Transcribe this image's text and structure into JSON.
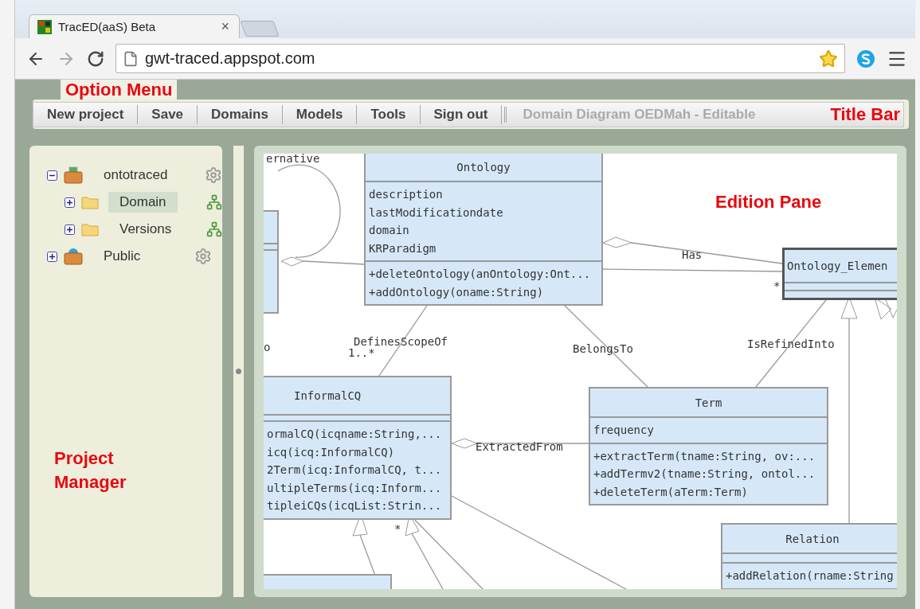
{
  "browser": {
    "tab": {
      "title": "TracED(aaS) Beta",
      "close": "×"
    },
    "address": "gwt-traced.appspot.com"
  },
  "annotations": [
    {
      "text": "Option Menu"
    },
    {
      "text": "Title Bar"
    },
    {
      "text": "Project Manager"
    },
    {
      "text": "Edition Pane"
    }
  ],
  "menu": {
    "items": [
      "New project",
      "Save",
      "Domains",
      "Models",
      "Tools",
      "Sign out"
    ],
    "title": "Domain Diagram OEDMah - Editable"
  },
  "project_tree": [
    {
      "label": "ontotraced",
      "kind": "project",
      "expanded": true,
      "selected": false,
      "children": [
        {
          "label": "Domain",
          "kind": "folder",
          "expanded": false,
          "selected": true
        },
        {
          "label": "Versions",
          "kind": "folder",
          "expanded": false,
          "selected": false
        }
      ]
    },
    {
      "label": "Public",
      "kind": "public",
      "expanded": false,
      "selected": false
    }
  ],
  "diagram": {
    "classes": [
      {
        "name": "Ontology",
        "selected": false,
        "attributes": [
          "description",
          "lastModificationdate",
          "domain",
          "KRParadigm"
        ],
        "methods": [
          "+deleteOntology(anOntology:Ont...",
          "+addOntology(oname:String)"
        ]
      },
      {
        "name": "Ontology_Elemen",
        "selected": true
      },
      {
        "name": "InformalCQ",
        "selected": false,
        "methods": [
          "ormalCQ(icqname:String,...",
          "icq(icq:InformalCQ)",
          "2Term(icq:InformalCQ, t...",
          "ultipleTerms(icq:Inform...",
          "tipleiCQs(icqList:Strin..."
        ]
      },
      {
        "name": "Term",
        "selected": false,
        "attributes": [
          "frequency"
        ],
        "methods": [
          "+extractTerm(tname:String, ov:...",
          "+addTermv2(tname:String, ontol...",
          "+deleteTerm(aTerm:Term)"
        ]
      },
      {
        "name": "Relation",
        "selected": false,
        "methods": [
          "+addRelation(rname:String"
        ]
      }
    ],
    "labels": [
      "ernative",
      "Has",
      "*",
      "o",
      "1..*",
      "DefinesScopeOf",
      "BelongsTo",
      "IsRefinedInto",
      "ExtractedFrom",
      "*"
    ]
  }
}
